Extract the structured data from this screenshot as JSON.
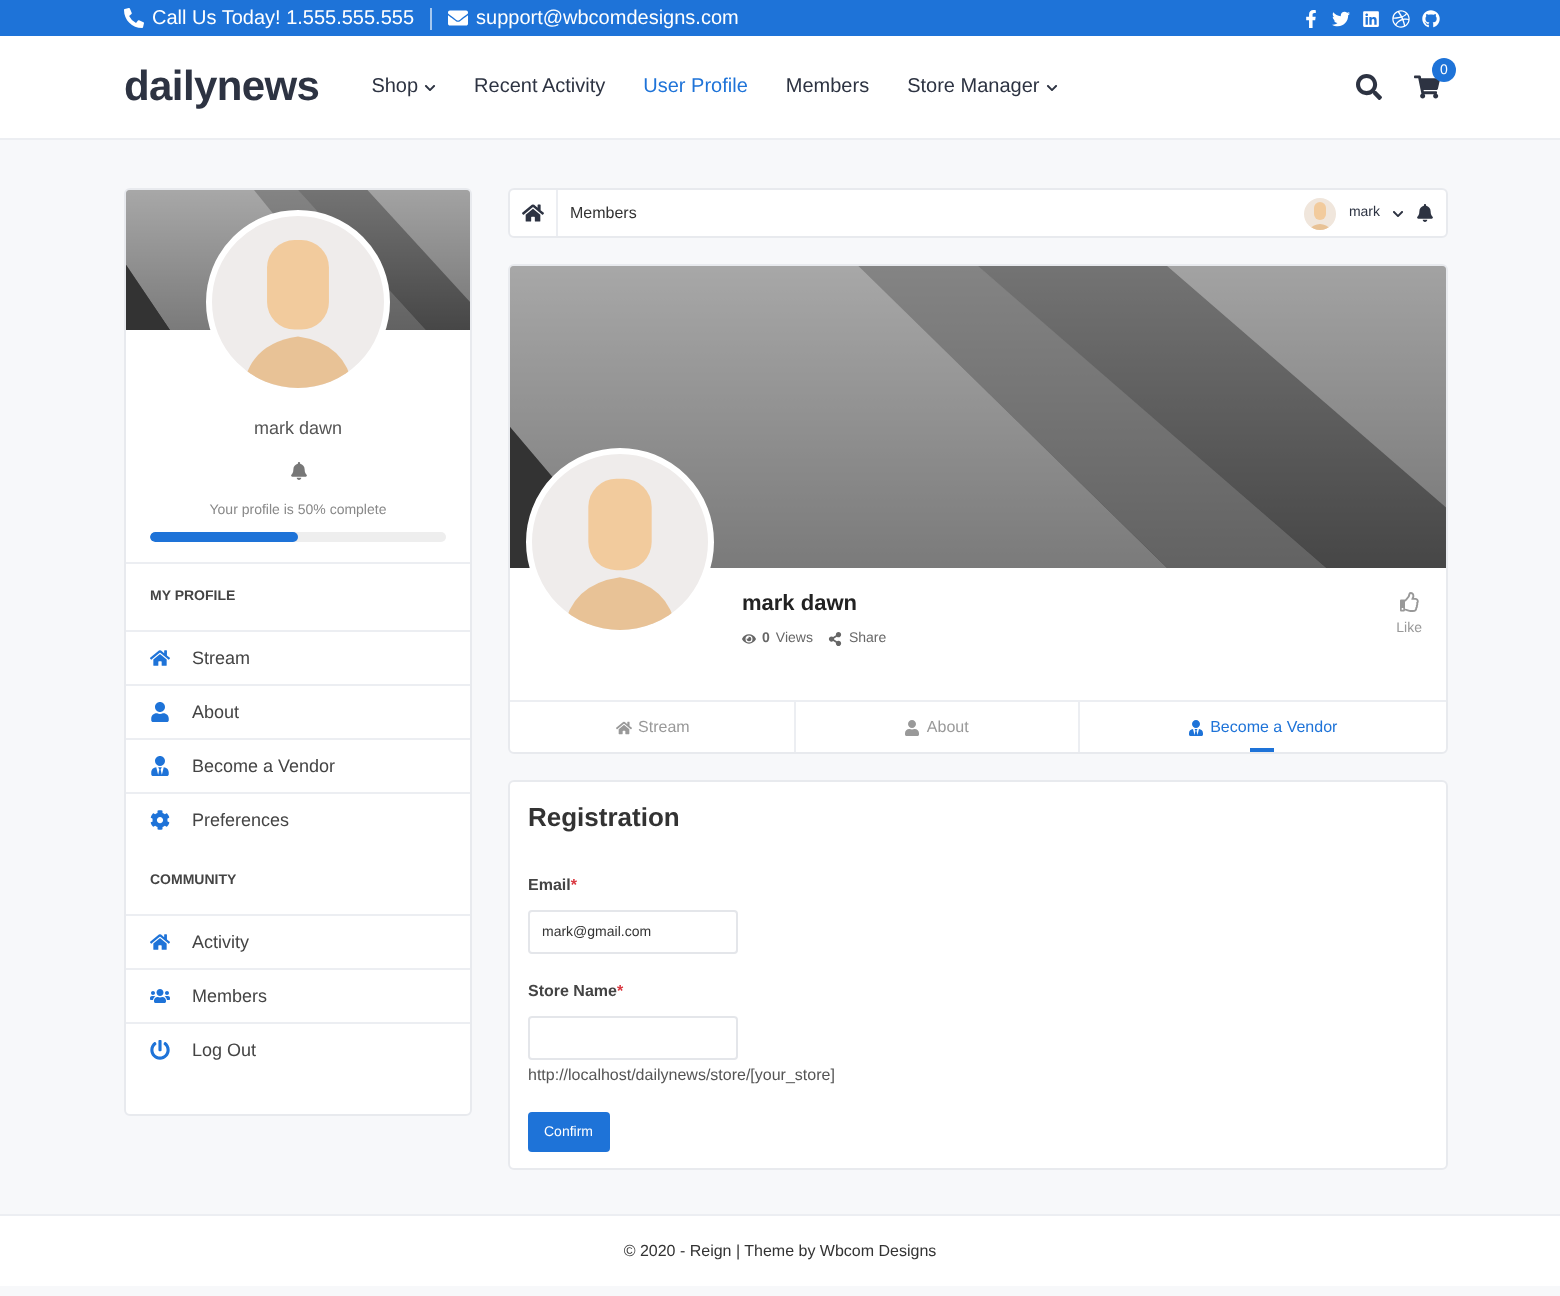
{
  "top_bar": {
    "phone": "Call Us Today! 1.555.555.555",
    "email": "support@wbcomdesigns.com"
  },
  "header": {
    "logo": "dailynews",
    "nav": [
      {
        "label": "Shop",
        "selected": false,
        "dropdown": true
      },
      {
        "label": "Recent Activity",
        "selected": false,
        "dropdown": false
      },
      {
        "label": "User Profile",
        "selected": true,
        "dropdown": false
      },
      {
        "label": "Members",
        "selected": false,
        "dropdown": false
      },
      {
        "label": "Store Manager",
        "selected": false,
        "dropdown": true
      }
    ],
    "cart_count": "0"
  },
  "sidebar": {
    "name": "mark dawn",
    "progress_text": "Your profile is 50% complete",
    "level": 0.5,
    "sections": [
      {
        "title": "MY PROFILE",
        "items": [
          "Stream",
          "About",
          "Become a Vendor",
          "Preferences"
        ]
      },
      {
        "title": "COMMUNITY",
        "items": [
          "Activity",
          "Members",
          "Log Out"
        ]
      }
    ]
  },
  "breadcrumb": {
    "label": "Members",
    "user": "mark"
  },
  "profile": {
    "name": "mark dawn",
    "views_count": "0",
    "views_label": "Views",
    "share": "Share",
    "like": "Like",
    "tabs": [
      {
        "label": "Stream",
        "selected": false
      },
      {
        "label": "About",
        "selected": false
      },
      {
        "label": "Become a Vendor",
        "selected": true
      }
    ]
  },
  "registration": {
    "title": "Registration",
    "fields": [
      {
        "label": "Email",
        "marker": "*",
        "value": "mark@gmail.com"
      },
      {
        "label": "Store Name",
        "marker": "*"
      }
    ],
    "hint": "http://localhost/dailynews/store/[your_store]",
    "button": "Confirm"
  },
  "footer": "© 2020 - Reign | Theme by Wbcom Designs"
}
